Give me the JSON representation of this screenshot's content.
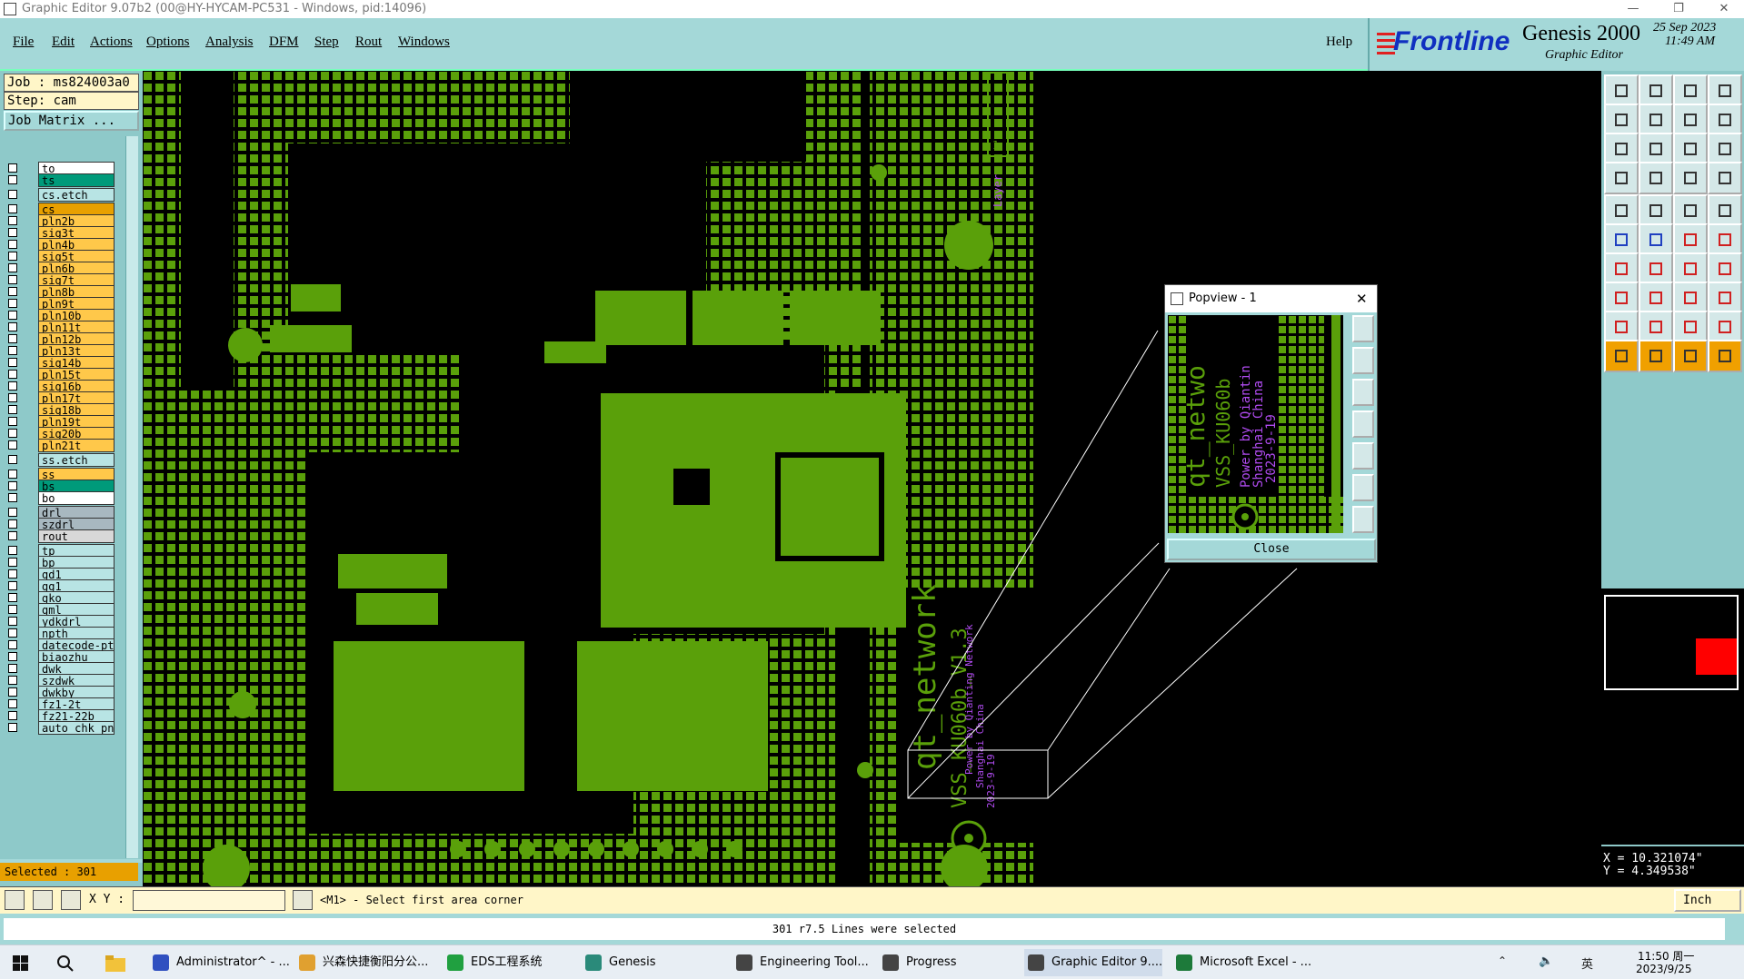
{
  "window": {
    "title": "Graphic Editor 9.07b2 (00@HY-HYCAM-PC531 - Windows, pid:14096)",
    "buttons": [
      "—",
      "❐",
      "✕"
    ]
  },
  "menu": {
    "items": [
      "File",
      "Edit",
      "Actions",
      "Options",
      "Analysis",
      "DFM",
      "Step",
      "Rout",
      "Windows"
    ],
    "help": "Help"
  },
  "brand": {
    "logo": "Frontline",
    "product": "Genesis 2000",
    "subtitle": "Graphic Editor",
    "date": "25 Sep 2023",
    "time": "11:49 AM"
  },
  "job": {
    "job_label": "Job : ms824003a0",
    "step_label": "Step: cam",
    "job_matrix": "Job Matrix ..."
  },
  "layers": [
    {
      "name": "to",
      "color": "#ffffff"
    },
    {
      "name": "ts",
      "color": "#009a7a"
    },
    {
      "name": "cs.etch",
      "color": "#b8e4e4"
    },
    {
      "name": "cs",
      "color": "#e8a000"
    },
    {
      "name": "pln2b",
      "color": "#ffc84a"
    },
    {
      "name": "sig3t",
      "color": "#ffc84a"
    },
    {
      "name": "pln4b",
      "color": "#ffc84a"
    },
    {
      "name": "sig5t",
      "color": "#ffc84a"
    },
    {
      "name": "pln6b",
      "color": "#ffc84a"
    },
    {
      "name": "sig7t",
      "color": "#ffc84a"
    },
    {
      "name": "pln8b",
      "color": "#ffc84a"
    },
    {
      "name": "pln9t",
      "color": "#ffc84a"
    },
    {
      "name": "pln10b",
      "color": "#ffc84a"
    },
    {
      "name": "pln11t",
      "color": "#ffc84a"
    },
    {
      "name": "pln12b",
      "color": "#ffc84a"
    },
    {
      "name": "pln13t",
      "color": "#ffc84a"
    },
    {
      "name": "sig14b",
      "color": "#ffc84a"
    },
    {
      "name": "pln15t",
      "color": "#ffc84a"
    },
    {
      "name": "sig16b",
      "color": "#ffc84a"
    },
    {
      "name": "pln17t",
      "color": "#ffc84a"
    },
    {
      "name": "sig18b",
      "color": "#ffc84a"
    },
    {
      "name": "pln19t",
      "color": "#ffc84a"
    },
    {
      "name": "sig20b",
      "color": "#ffc84a"
    },
    {
      "name": "pln21t",
      "color": "#ffc84a"
    },
    {
      "name": "ss.etch",
      "color": "#b8e4e4"
    },
    {
      "name": "ss",
      "color": "#ffc84a"
    },
    {
      "name": "bs",
      "color": "#009a7a"
    },
    {
      "name": "bo",
      "color": "#ffffff"
    },
    {
      "name": "drl",
      "color": "#a8b8c0"
    },
    {
      "name": "szdrl",
      "color": "#a8b8c0"
    },
    {
      "name": "rout",
      "color": "#d8d8d8"
    },
    {
      "name": "tp",
      "color": "#b8e4e4"
    },
    {
      "name": "bp",
      "color": "#b8e4e4"
    },
    {
      "name": "gd1",
      "color": "#b8e4e4"
    },
    {
      "name": "gg1",
      "color": "#b8e4e4"
    },
    {
      "name": "gko",
      "color": "#b8e4e4"
    },
    {
      "name": "gml",
      "color": "#b8e4e4"
    },
    {
      "name": "ydkdrl",
      "color": "#b8e4e4"
    },
    {
      "name": "npth",
      "color": "#b8e4e4"
    },
    {
      "name": "datecode-pth",
      "color": "#b8e4e4"
    },
    {
      "name": "biaozhu",
      "color": "#b8e4e4"
    },
    {
      "name": "dwk",
      "color": "#b8e4e4"
    },
    {
      "name": "szdwk",
      "color": "#b8e4e4"
    },
    {
      "name": "dwkby",
      "color": "#b8e4e4"
    },
    {
      "name": "fz1-2t",
      "color": "#b8e4e4"
    },
    {
      "name": "fz21-22b",
      "color": "#b8e4e4"
    },
    {
      "name": "auto_chk_pn",
      "color": "#b8e4e4"
    }
  ],
  "selected_label": "Selected : 301",
  "board": {
    "net_text": "qt_network",
    "part_text": "VSS_KU060b_V1.3",
    "power_text": "Power by Qianting Network",
    "city_text": "Shanghai China",
    "date_text": "2023-9-19",
    "layer_tag": "Layer",
    "layer_tag_num": "1"
  },
  "popview": {
    "title": "Popview - 1",
    "close_x": "✕",
    "net_text": "qt_netwo",
    "part_text": "VSS_KU060b",
    "power_text": "Power by Qiantin",
    "city_text": "Shanghai China",
    "date_text": "2023-9-19",
    "close_button": "Close"
  },
  "coords": {
    "x": "X = 10.321074\"",
    "y": "Y = 4.349538\""
  },
  "command": {
    "xy_label": "X Y :",
    "xy_value": "",
    "prompt": "<M1> - Select first area corner",
    "units": "Inch"
  },
  "status": "301 r7.5 Lines were selected",
  "taskbar": {
    "items": [
      "Administrator^ - ...",
      "兴森快捷衡阳分公...",
      "EDS工程系统",
      "Genesis",
      "Engineering Tool...",
      "Progress",
      "Graphic Editor 9....",
      "Microsoft Excel - ..."
    ],
    "ime": "英",
    "clock_time": "11:50 周一",
    "clock_date": "2023/9/25"
  },
  "colors": {
    "copper": "#5aa00a",
    "panel": "#a4d8d8",
    "label_purple": "#b04bf0"
  }
}
